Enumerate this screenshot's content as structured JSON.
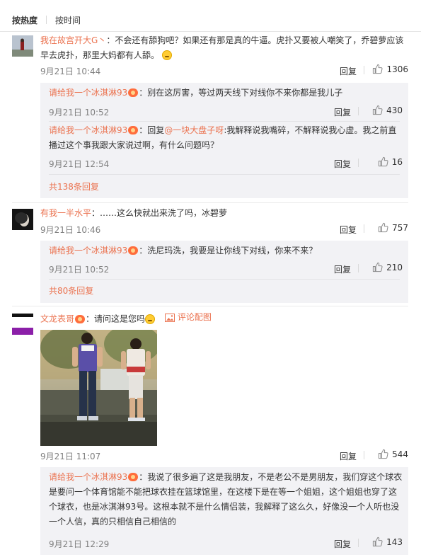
{
  "sort": {
    "hot": "按热度",
    "time": "按时间"
  },
  "like_icon": "thumbs-up-icon",
  "reply_label": "回复",
  "comments": [
    {
      "user": "我在故宫开大G丶",
      "text": "：不会还有舔狗吧？如果还有那是真的牛逼。虎扑又要被人嘲笑了，乔碧萝应该早去虎扑，那里大妈都有人舔。",
      "time": "9月21日 10:44",
      "likes": "1306",
      "replies": [
        {
          "user": "请给我一个冰淇淋93",
          "text": "：别在这厉害，等过两天线下对线你不来你都是我儿子",
          "time": "9月21日 10:52",
          "likes": "430"
        },
        {
          "user": "请给我一个冰淇淋93",
          "prefix": "：回复",
          "mention": "@一块大盘子呀",
          "text": ":我解释说我嘴碎，不解释说我心虚。我之前直播过这个事我跟大家说过啊，有什么问题吗？",
          "time": "9月21日 12:54",
          "likes": "16"
        }
      ],
      "more": "共138条回复"
    },
    {
      "user": "有我一半水平",
      "text": "：……这么快就出来洗了吗，冰碧萝",
      "time": "9月21日 10:46",
      "likes": "757",
      "replies": [
        {
          "user": "请给我一个冰淇淋93",
          "text": "：洗尼玛洗，我要是让你线下对线，你来不来？",
          "time": "9月21日 10:52",
          "likes": "210"
        }
      ],
      "more": "共80条回复"
    },
    {
      "user": "文龙表哥",
      "text": "：请问这是您吗",
      "pic_label": "评论配图",
      "time": "9月21日 11:07",
      "likes": "544",
      "replies": [
        {
          "user": "请给我一个冰淇淋93",
          "text": "：我说了很多遍了这是我朋友，不是老公不是男朋友，我们穿这个球衣是要问一个体育馆能不能把球衣挂在篮球馆里，在这楼下是在等一个姐姐，这个姐姐也穿了这个球衣，也是冰淇淋93号。这根本就不是什么情侣装，我解释了这么久，好像没一个人听也没一个人信，真的只相信自己相信的",
          "time": "9月21日 12:29",
          "likes": "143"
        }
      ]
    }
  ],
  "colors": {
    "accent": "#eb7350",
    "sub_bg": "#f2f2f5",
    "meta": "#808080"
  }
}
